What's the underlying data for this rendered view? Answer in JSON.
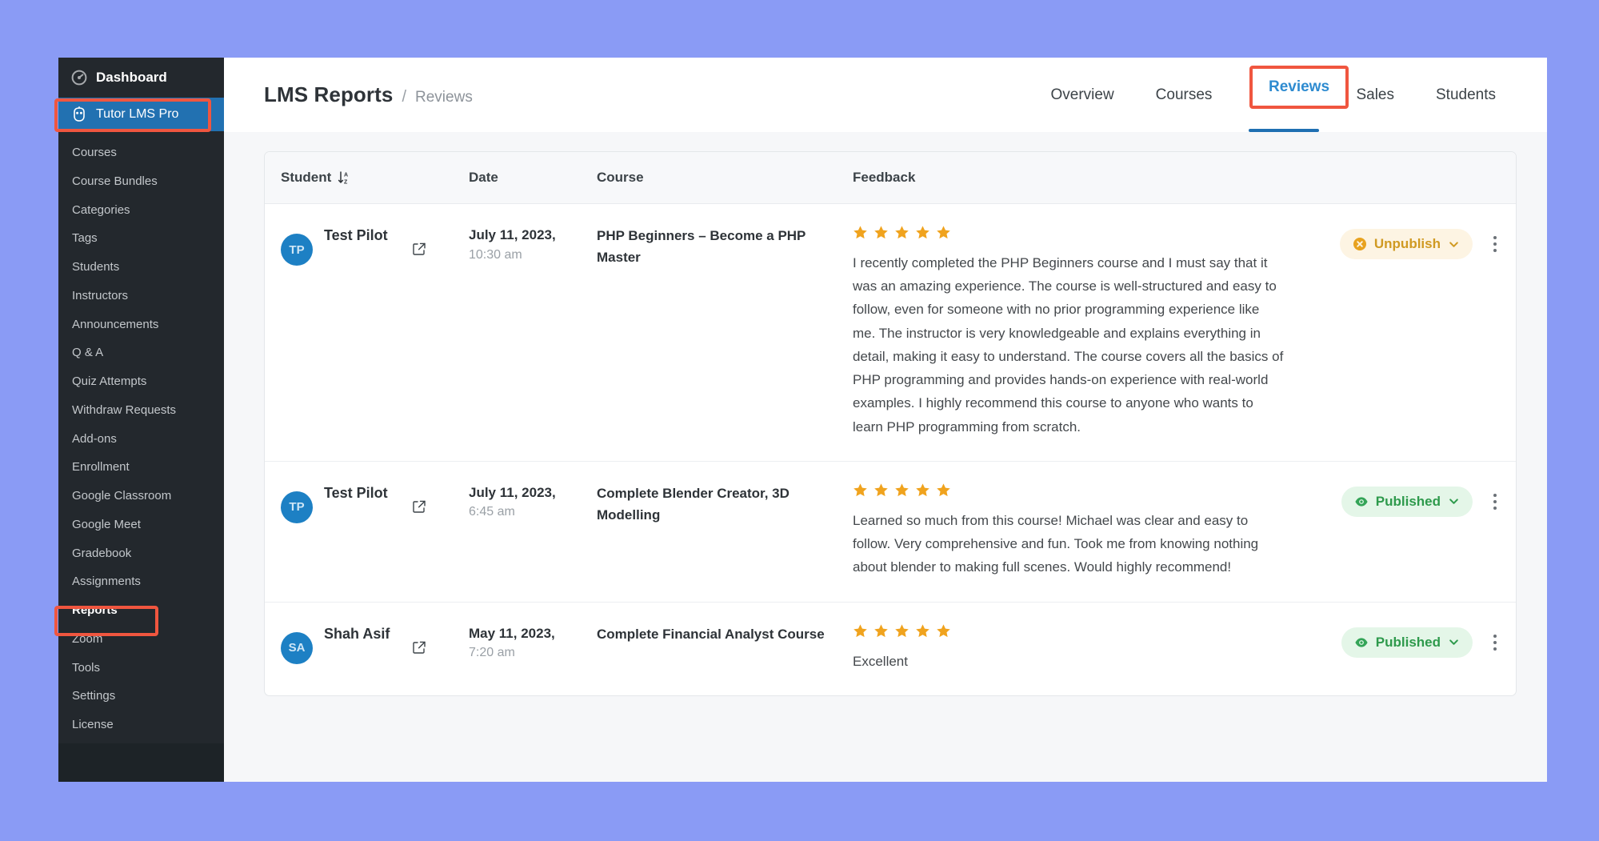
{
  "window": {
    "sidebar": {
      "dashboard_label": "Dashboard",
      "dashboard_icon": "speedometer-icon",
      "active_plugin_label": "Tutor LMS Pro",
      "active_plugin_icon": "tutor-owl-icon",
      "items": [
        {
          "label": "Courses",
          "active": false
        },
        {
          "label": "Course Bundles",
          "active": false
        },
        {
          "label": "Categories",
          "active": false
        },
        {
          "label": "Tags",
          "active": false
        },
        {
          "label": "Students",
          "active": false
        },
        {
          "label": "Instructors",
          "active": false
        },
        {
          "label": "Announcements",
          "active": false
        },
        {
          "label": "Q & A",
          "active": false
        },
        {
          "label": "Quiz Attempts",
          "active": false
        },
        {
          "label": "Withdraw Requests",
          "active": false
        },
        {
          "label": "Add-ons",
          "active": false
        },
        {
          "label": "Enrollment",
          "active": false
        },
        {
          "label": "Google Classroom",
          "active": false
        },
        {
          "label": "Google Meet",
          "active": false
        },
        {
          "label": "Gradebook",
          "active": false
        },
        {
          "label": "Assignments",
          "active": false
        },
        {
          "label": "Reports",
          "active": true
        },
        {
          "label": "Zoom",
          "active": false
        },
        {
          "label": "Tools",
          "active": false
        },
        {
          "label": "Settings",
          "active": false
        },
        {
          "label": "License",
          "active": false
        }
      ]
    },
    "header": {
      "title": "LMS Reports",
      "separator": "/",
      "current": "Reviews"
    },
    "tabs": [
      {
        "label": "Overview",
        "active": false
      },
      {
        "label": "Courses",
        "active": false
      },
      {
        "label": "Reviews",
        "active": true
      },
      {
        "label": "Sales",
        "active": false
      },
      {
        "label": "Students",
        "active": false
      }
    ],
    "table": {
      "columns": {
        "student": "Student",
        "student_sort_icon": "sort-az-descending-icon",
        "date": "Date",
        "course": "Course",
        "feedback": "Feedback",
        "status": ""
      },
      "rows": [
        {
          "avatar_initials": "TP",
          "student_name": "Test Pilot",
          "open_link_icon": "external-link-icon",
          "date": "July 11, 2023,",
          "time": "10:30 am",
          "course": "PHP Beginners – Become a PHP Master",
          "rating": 5,
          "feedback": "I recently completed the PHP Beginners course and I must say that it was an amazing experience. The course is well-structured and easy to follow, even for someone with no prior programming experience like me. The instructor is very knowledgeable and explains everything in detail, making it easy to understand. The course covers all the basics of PHP programming and provides hands-on experience with real-world examples. I highly recommend this course to anyone who wants to learn PHP programming from scratch.",
          "status_label": "Unpublish",
          "status_type": "unpublish",
          "status_icon": "x-circle-icon",
          "menu_icon": "kebab-menu-icon"
        },
        {
          "avatar_initials": "TP",
          "student_name": "Test Pilot",
          "open_link_icon": "external-link-icon",
          "date": "July 11, 2023,",
          "time": "6:45 am",
          "course": "Complete Blender Creator, 3D Modelling",
          "rating": 5,
          "feedback": "Learned so much from this course! Michael was clear and easy to follow. Very comprehensive and fun. Took me from knowing nothing about blender to making full scenes. Would highly recommend!",
          "status_label": "Published",
          "status_type": "published",
          "status_icon": "eye-icon",
          "menu_icon": "kebab-menu-icon"
        },
        {
          "avatar_initials": "SA",
          "student_name": "Shah Asif",
          "open_link_icon": "external-link-icon",
          "date": "May 11, 2023,",
          "time": "7:20 am",
          "course": "Complete Financial Analyst Course",
          "rating": 5,
          "feedback": "Excellent",
          "status_label": "Published",
          "status_type": "published",
          "status_icon": "eye-icon",
          "menu_icon": "kebab-menu-icon"
        }
      ]
    }
  },
  "annotations": {
    "tutor_lms_pro": "Tutor LMS Pro",
    "reports": "Reports",
    "reviews": "Reviews"
  },
  "colors": {
    "page_background": "#8a9bf5",
    "sidebar_background": "#23282d",
    "sidebar_active": "#2271b1",
    "annotation_red": "#f0563f",
    "tab_active_blue": "#2271b1",
    "star_orange": "#f0a31e",
    "badge_unpublish_text": "#d09a22",
    "badge_published_text": "#2e9a4c",
    "avatar_blue": "#1d80c4"
  }
}
